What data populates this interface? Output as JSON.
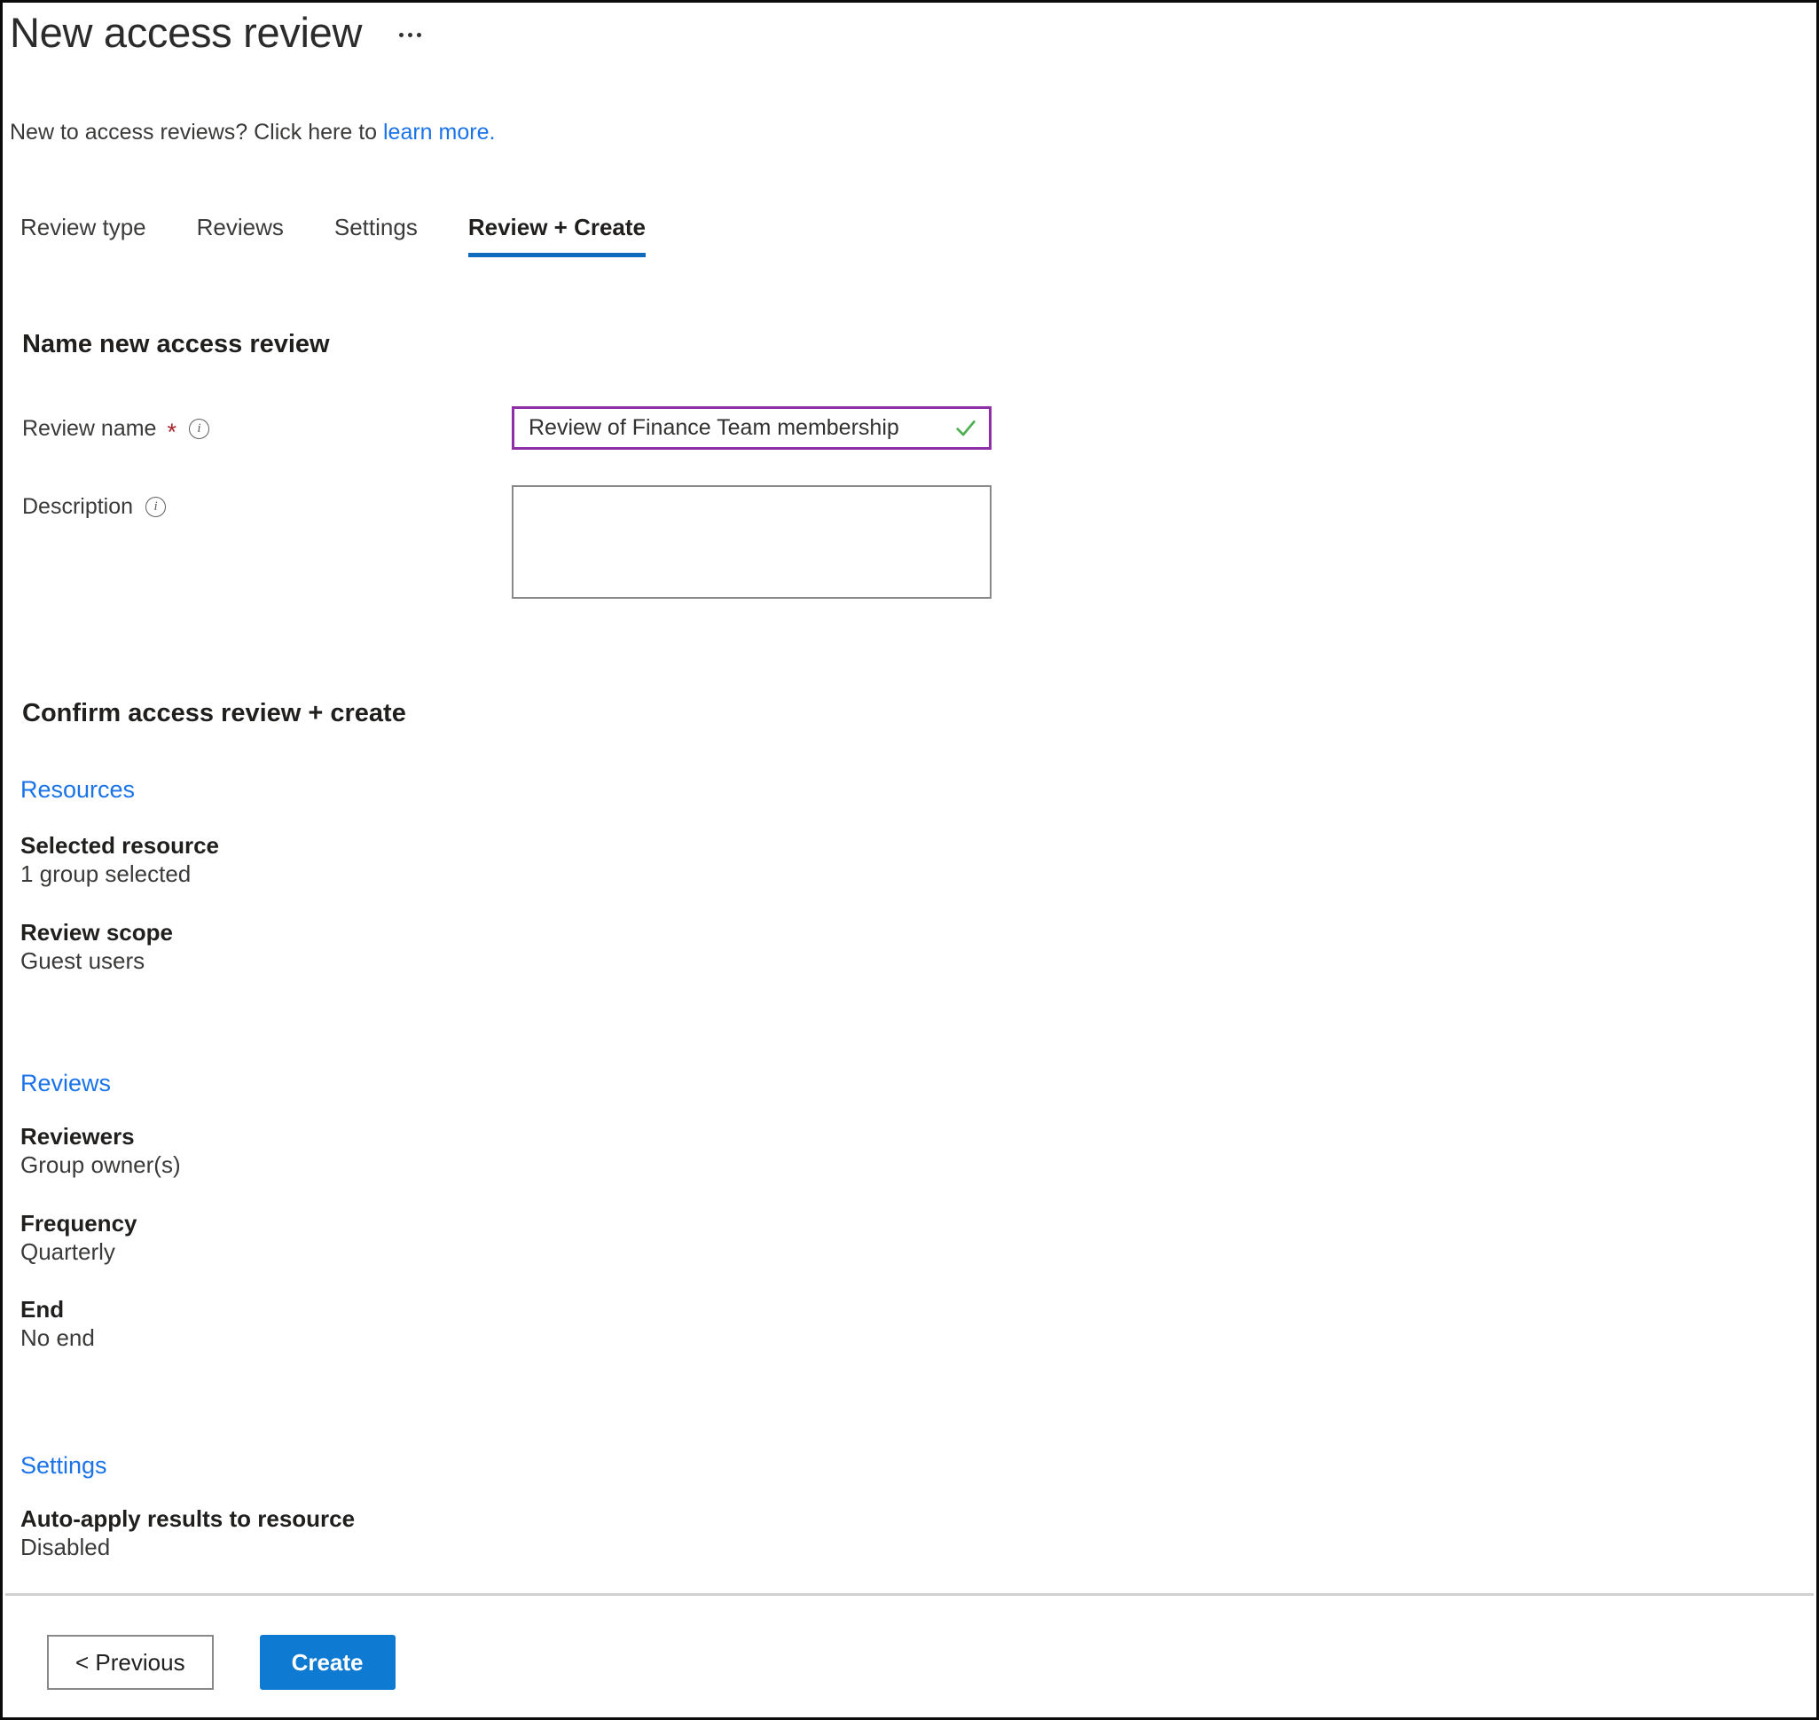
{
  "header": {
    "title": "New access review",
    "more_menu": "…",
    "subtitle_prefix": "New to access reviews? Click here to ",
    "subtitle_link": "learn more."
  },
  "tabs": [
    {
      "label": "Review type",
      "active": false
    },
    {
      "label": "Reviews",
      "active": false
    },
    {
      "label": "Settings",
      "active": false
    },
    {
      "label": "Review + Create",
      "active": true
    }
  ],
  "name_section": {
    "heading": "Name new access review",
    "review_name": {
      "label": "Review name",
      "required_marker": "*",
      "info": "i",
      "value": "Review of Finance Team membership",
      "placeholder": ""
    },
    "description": {
      "label": "Description",
      "info": "i",
      "value": "",
      "placeholder": ""
    }
  },
  "confirm_section": {
    "heading": "Confirm access review + create",
    "groups": [
      {
        "link": "Resources",
        "items": [
          {
            "key": "Selected resource",
            "value": "1 group selected"
          },
          {
            "key": "Review scope",
            "value": "Guest users"
          }
        ]
      },
      {
        "link": "Reviews",
        "items": [
          {
            "key": "Reviewers",
            "value": "Group owner(s)"
          },
          {
            "key": "Frequency",
            "value": "Quarterly"
          },
          {
            "key": "End",
            "value": "No end"
          }
        ]
      },
      {
        "link": "Settings",
        "items": [
          {
            "key": "Auto-apply results to resource",
            "value": "Disabled"
          }
        ]
      }
    ]
  },
  "footer": {
    "previous_label": "< Previous",
    "create_label": "Create"
  },
  "colors": {
    "accent_blue": "#0f6cbd",
    "link_blue": "#1a73e8",
    "primary_button": "#0f7ad1",
    "input_focus_border": "#8e2fa8",
    "valid_check": "#4caf50",
    "required_red": "#a4262c",
    "text_primary": "#201f1e",
    "text_secondary": "#3b3a39"
  },
  "icons": {
    "more": "ellipsis-icon",
    "info": "info-icon",
    "valid": "checkmark-icon"
  }
}
